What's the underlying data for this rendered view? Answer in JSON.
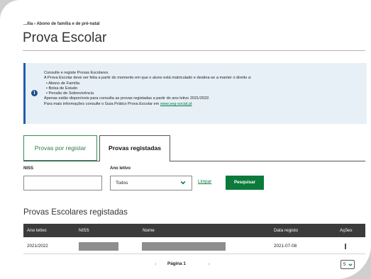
{
  "breadcrumb": {
    "text": "...ília › Abono de família e de pré-natal"
  },
  "page": {
    "title": "Prova Escolar"
  },
  "info": {
    "lines": [
      "Consulte e registe Provas Escolares.",
      "A Prova Escolar deve ser feita a partir do momento em que o aluno está matriculado e destina-se a manter o direito a:",
      "Abono de Família",
      "Bolsa de Estudo",
      "Pensão de Sobrevivência",
      "Apenas estão disponíveis para consulta as provas registadas a partir do ano letivo 2021/2022.",
      "Para mais informações consulte o Guia Prático Prova Escolar em "
    ],
    "link": "www.seg-social.pt",
    "icon": "info-icon"
  },
  "tabs": [
    {
      "label": "Provas por registar"
    },
    {
      "label": "Provas registadas"
    }
  ],
  "filters": {
    "niss_label": "NISS",
    "niss_value": "",
    "year_label": "Ano letivo",
    "year_value": "Todos",
    "clear_label": "Limpar",
    "search_label": "Pesquisar"
  },
  "results": {
    "title": "Provas Escolares registadas",
    "columns": [
      "Ano letivo",
      "NISS",
      "Nome",
      "Data registo",
      "Ações"
    ],
    "rows": [
      {
        "ano_letivo": "2021/2022",
        "niss": "",
        "nome": "",
        "data_registo": "2021-07-08",
        "acoes": "⋮"
      }
    ]
  },
  "pagination": {
    "prev": "‹",
    "label": "Página 1",
    "next": "›",
    "page_size": "5"
  },
  "colors": {
    "accent_green": "#0b7a3b",
    "info_blue": "#1f5ea8",
    "table_header": "#3b3b3b"
  }
}
